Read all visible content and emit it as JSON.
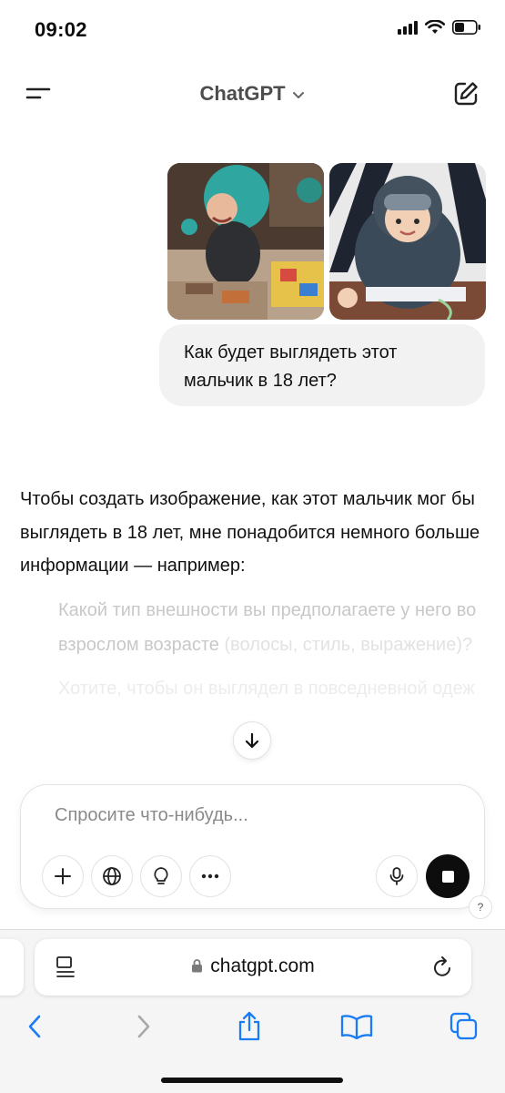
{
  "status_bar": {
    "time": "09:02"
  },
  "header": {
    "title": "ChatGPT"
  },
  "user_message": {
    "text": "Как будет выглядеть этот мальчик в 18 лет?"
  },
  "assistant_message": {
    "text": "Чтобы создать изображение, как этот мальчик мог бы выглядеть в 18 лет, мне понадобится немного больше информации — например:",
    "bullets": [
      {
        "text": "Какой тип внешности вы предполагаете у него во взрослом возрасте",
        "tail": " (волосы, стиль, выражение)?"
      },
      {
        "text": "Хотите, чтобы он выглядел в повседневной одеж"
      }
    ]
  },
  "composer": {
    "placeholder": "Спросите что-нибудь..."
  },
  "help": {
    "label": "?"
  },
  "browser": {
    "url": "chatgpt.com"
  },
  "icons": {
    "status": [
      "signal-icon",
      "wifi-icon",
      "battery-icon"
    ],
    "header": [
      "menu-icon",
      "chevron-down-icon",
      "compose-icon"
    ],
    "composer_tools": [
      "plus-icon",
      "globe-icon",
      "lightbulb-icon",
      "more-icon",
      "microphone-icon",
      "stop-icon"
    ],
    "browser": [
      "reader-icon",
      "lock-icon",
      "reload-icon",
      "back-icon",
      "forward-icon",
      "share-icon",
      "bookmarks-icon",
      "tabs-icon"
    ]
  },
  "colors": {
    "accent_black": "#0d0d0d",
    "bubble_bg": "#f2f2f2",
    "safari_blue": "#1a7cf5"
  }
}
